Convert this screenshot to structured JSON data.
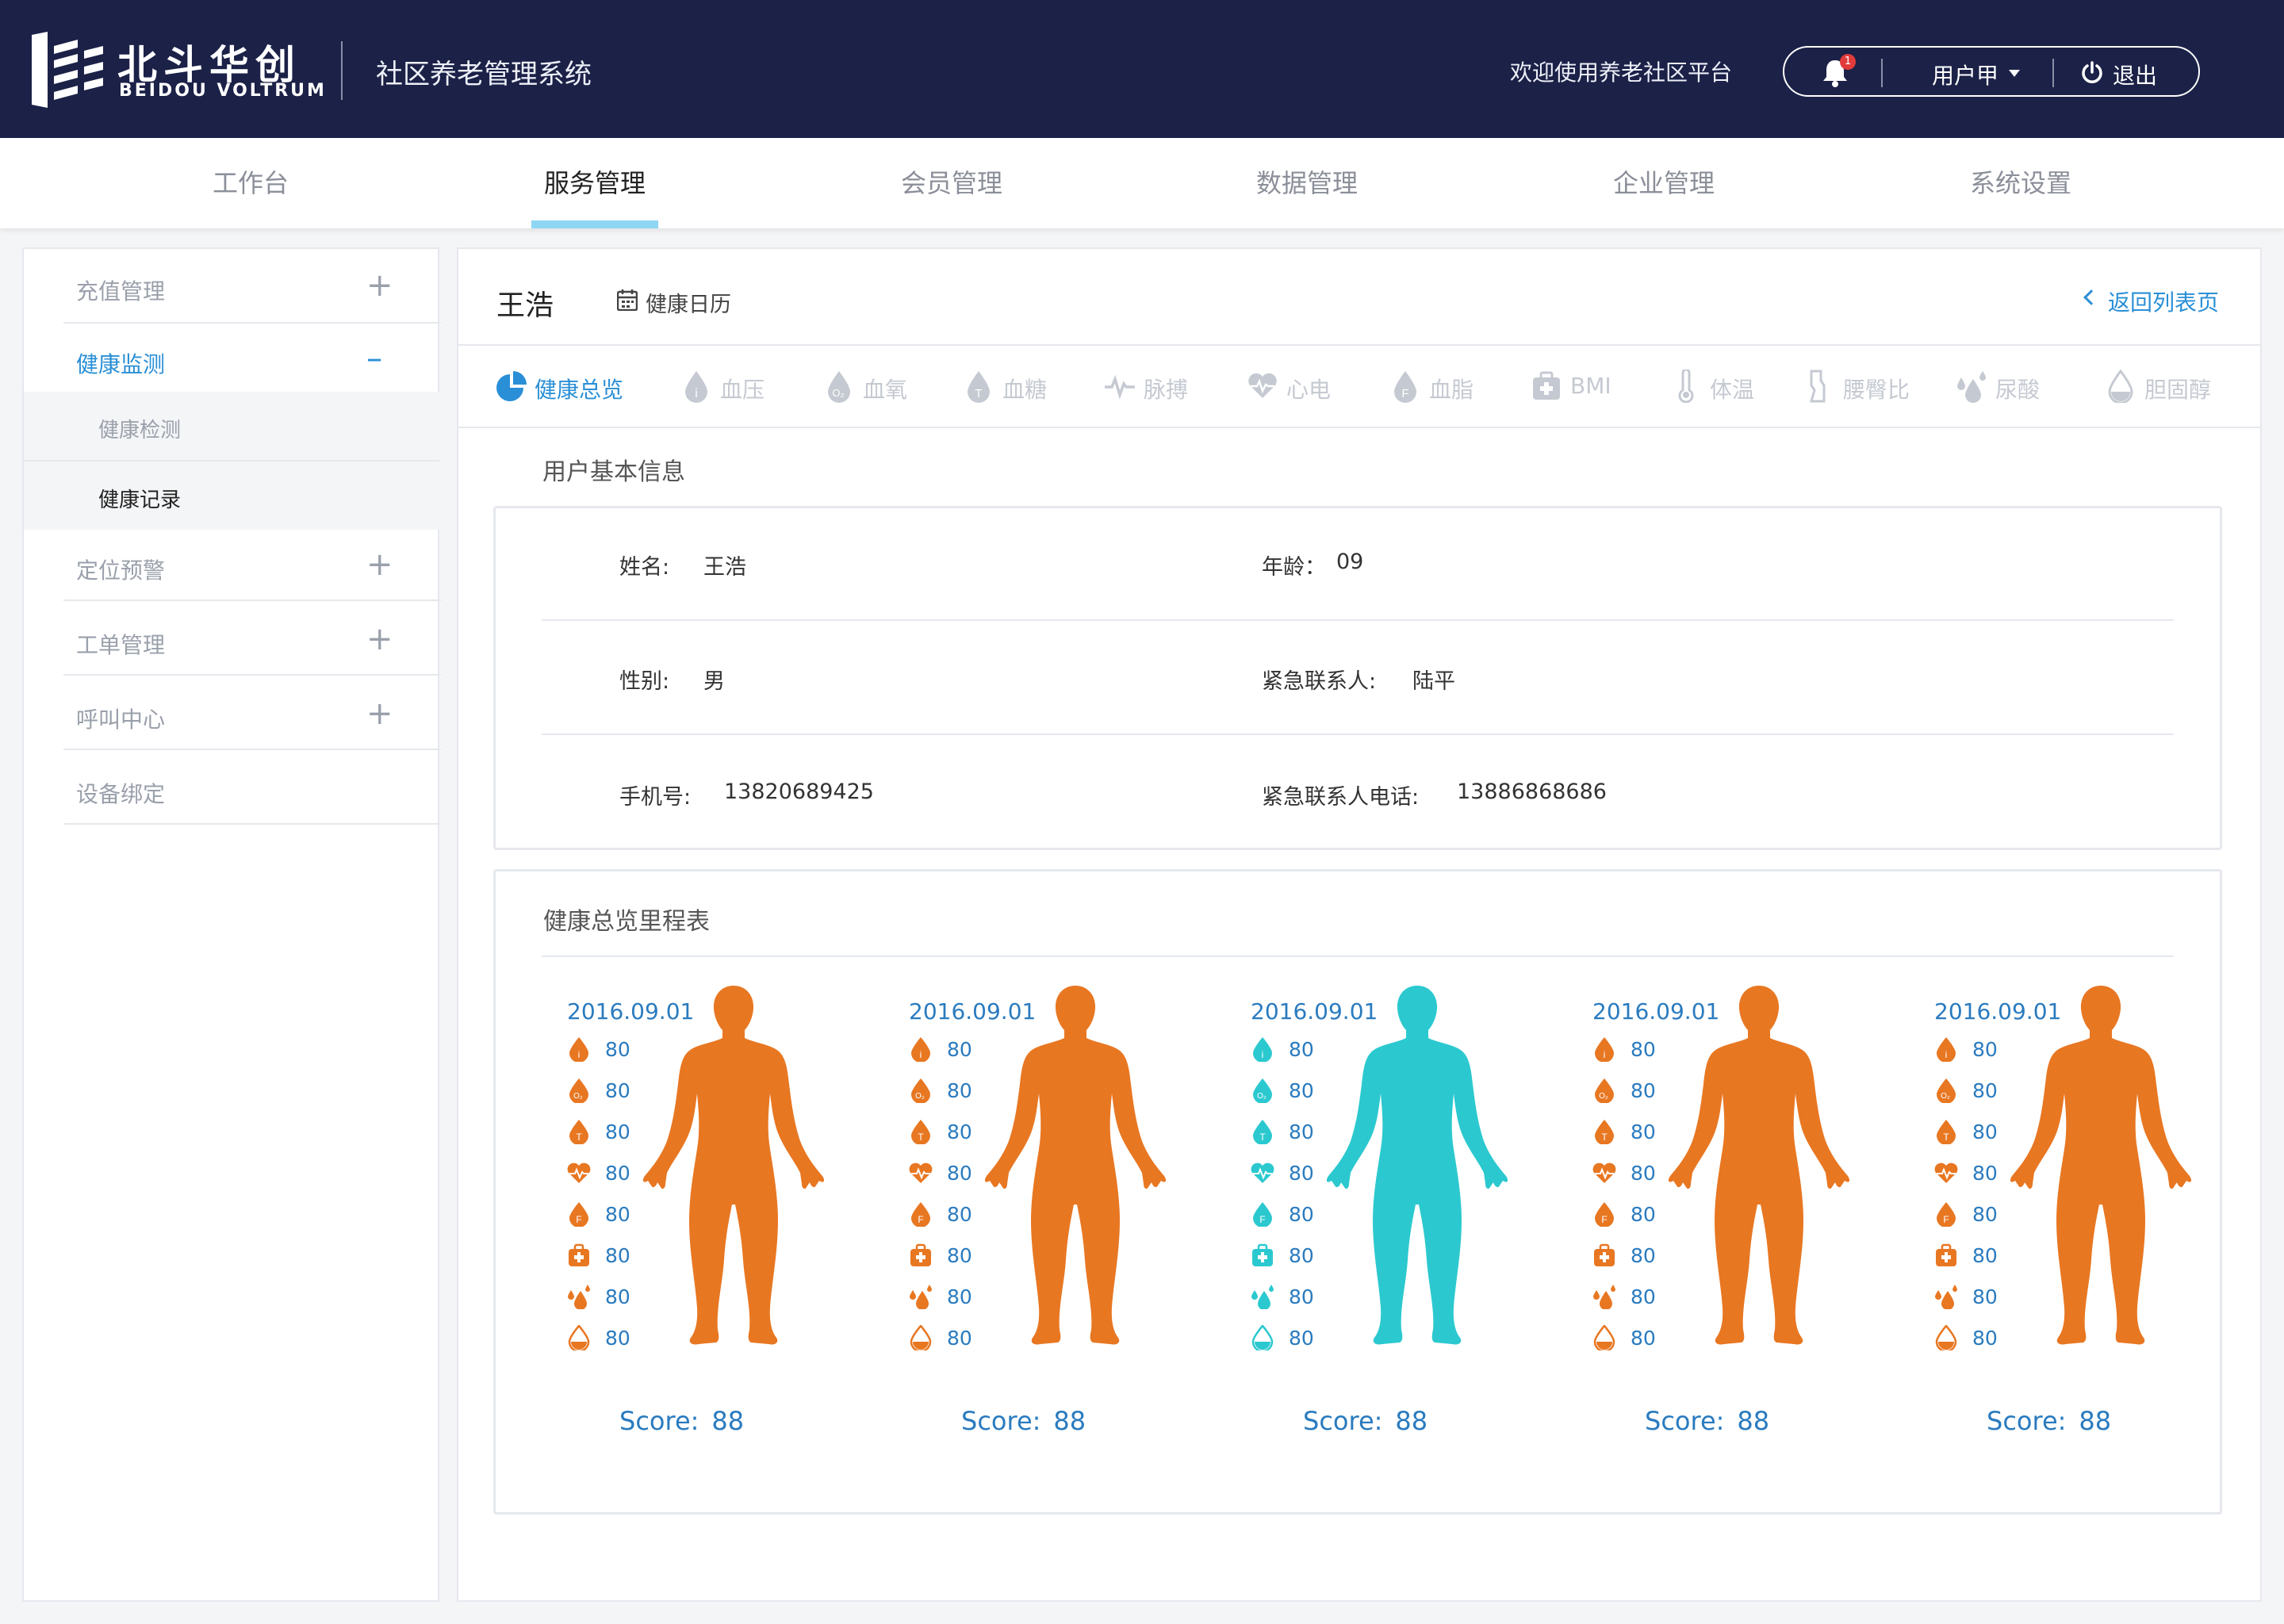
{
  "header": {
    "logo_cn": "北斗华创",
    "logo_en": "BEIDOU VOLTRUM",
    "system_title": "社区养老管理系统",
    "welcome": "欢迎使用养老社区平台",
    "notification_count": "1",
    "user_name": "用户甲",
    "logout_label": "退出"
  },
  "nav": {
    "tabs": [
      "工作台",
      "服务管理",
      "会员管理",
      "数据管理",
      "企业管理",
      "系统设置"
    ],
    "active_index": 1
  },
  "sidebar": {
    "items": [
      "充值管理",
      "健康监测",
      "定位预警",
      "工单管理",
      "呼叫中心",
      "设备绑定"
    ],
    "sub_items": [
      "健康检测",
      "健康记录"
    ],
    "open_item": "健康监测",
    "active_sub": "健康记录",
    "toggle_plus": "+",
    "toggle_minus": "–"
  },
  "main": {
    "patient_name": "王浩",
    "calendar_label": "健康日历",
    "back_label": "返回列表页",
    "metric_tabs": [
      "健康总览",
      "血压",
      "血氧",
      "血糖",
      "脉搏",
      "心电",
      "血脂",
      "BMI",
      "体温",
      "腰臀比",
      "尿酸",
      "胆固醇"
    ],
    "active_metric": "健康总览",
    "basic_info_title": "用户基本信息",
    "info": {
      "name_label": "姓名:",
      "name_value": "王浩",
      "age_label": "年龄：",
      "age_value": "09",
      "gender_label": "性别:",
      "gender_value": "男",
      "contact_label": "紧急联系人:",
      "contact_value": "陆平",
      "phone_label": "手机号:",
      "phone_value": "13820689425",
      "contact_phone_label": "紧急联系人电话:",
      "contact_phone_value": "13886868686"
    },
    "chart_title": "健康总览里程表",
    "score_label": "Score:",
    "entries": [
      {
        "date": "2016.09.01",
        "values": [
          "80",
          "80",
          "80",
          "80",
          "80",
          "80",
          "80",
          "80"
        ],
        "score": "88",
        "status": "warning"
      },
      {
        "date": "2016.09.01",
        "values": [
          "80",
          "80",
          "80",
          "80",
          "80",
          "80",
          "80",
          "80"
        ],
        "score": "88",
        "status": "warning"
      },
      {
        "date": "2016.09.01",
        "values": [
          "80",
          "80",
          "80",
          "80",
          "80",
          "80",
          "80",
          "80"
        ],
        "score": "88",
        "status": "normal"
      },
      {
        "date": "2016.09.01",
        "values": [
          "80",
          "80",
          "80",
          "80",
          "80",
          "80",
          "80",
          "80"
        ],
        "score": "88",
        "status": "warning"
      },
      {
        "date": "2016.09.01",
        "values": [
          "80",
          "80",
          "80",
          "80",
          "80",
          "80",
          "80",
          "80"
        ],
        "score": "88",
        "status": "warning"
      }
    ],
    "row_icons": [
      "blood-pressure-icon",
      "blood-oxygen-icon",
      "blood-sugar-icon",
      "ecg-icon",
      "blood-lipid-icon",
      "bmi-icon",
      "uric-acid-icon",
      "cholesterol-icon"
    ]
  },
  "colors": {
    "header_bg": "#1b2147",
    "accent": "#2a8fd6",
    "warning": "#e87722",
    "normal": "#2bc9cf",
    "value_text": "#2a7bbf",
    "inactive_icon": "#c5c9d1"
  }
}
